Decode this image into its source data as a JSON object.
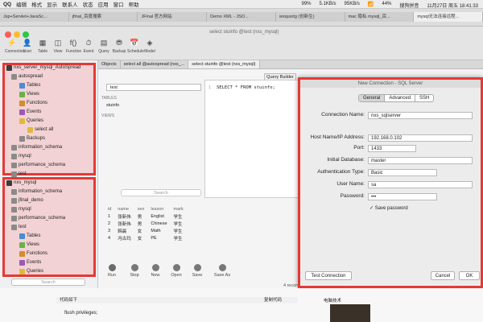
{
  "menubar": {
    "app": "QQ",
    "items": [
      "编辑",
      "格式",
      "显示",
      "联系人",
      "状态",
      "应用",
      "窗口",
      "帮助"
    ],
    "battery": "99%",
    "speed_up": "5.1KB/s",
    "speed_down": "95KB/s",
    "battery2": "44%",
    "search_label": "搜狗拼音",
    "datetime": "11月27日 周五 18:41:33"
  },
  "browser": {
    "tabs": [
      "Jsp+Servlet+JavaSc...",
      "jfinal_百度搜索",
      "JFinal 官方网站",
      "Demo XML - JSO...",
      "wxqusrtg (创新生)",
      "mac 隐私 mysql_百...",
      "mysql无法连接远程..."
    ]
  },
  "nav": {
    "window_title": "select stuinfo @test (nxs_mysql)",
    "tools": [
      {
        "name": "connection",
        "label": "Connection",
        "icon": "⚡"
      },
      {
        "name": "user",
        "label": "User",
        "icon": "👤"
      },
      {
        "name": "table",
        "label": "Table",
        "icon": "▦"
      },
      {
        "name": "view",
        "label": "View",
        "icon": "◫"
      },
      {
        "name": "function",
        "label": "Function",
        "icon": "f()"
      },
      {
        "name": "event",
        "label": "Event",
        "icon": "⏱"
      },
      {
        "name": "query",
        "label": "Query",
        "icon": "▤"
      },
      {
        "name": "backup",
        "label": "Backup",
        "icon": "⛃"
      },
      {
        "name": "schedule",
        "label": "Schedule",
        "icon": "📅"
      },
      {
        "name": "model",
        "label": "Model",
        "icon": "◈"
      }
    ]
  },
  "sidebar": {
    "group1": {
      "title": "nxs_server_mysql_AutoSpread",
      "items": [
        {
          "label": "autospread",
          "type": "db"
        },
        {
          "label": "Tables",
          "type": "tb"
        },
        {
          "label": "Views",
          "type": "vw"
        },
        {
          "label": "Functions",
          "type": "fn"
        },
        {
          "label": "Events",
          "type": "ev"
        },
        {
          "label": "Queries",
          "type": "qu"
        },
        {
          "label": "select all",
          "type": "qu"
        },
        {
          "label": "Backups",
          "type": "bk"
        },
        {
          "label": "information_schema",
          "type": "db"
        },
        {
          "label": "mysql",
          "type": "db"
        },
        {
          "label": "performance_schema",
          "type": "db"
        },
        {
          "label": "test",
          "type": "db"
        }
      ]
    },
    "group2": {
      "title": "nxs_mysql",
      "items": [
        {
          "label": "information_schema",
          "type": "db"
        },
        {
          "label": "jfinal_demo",
          "type": "db"
        },
        {
          "label": "mysql",
          "type": "db"
        },
        {
          "label": "performance_schema",
          "type": "db"
        },
        {
          "label": "test",
          "type": "db"
        },
        {
          "label": "Tables",
          "type": "tb"
        },
        {
          "label": "Views",
          "type": "vw"
        },
        {
          "label": "Functions",
          "type": "fn"
        },
        {
          "label": "Events",
          "type": "ev"
        },
        {
          "label": "Queries",
          "type": "qu"
        }
      ]
    },
    "search_placeholder": "Search"
  },
  "main": {
    "objtabs": [
      "Objects",
      "select all @autospread (nxs_...",
      "select stuinfo @test (nxs_mysql)"
    ],
    "editor_sql": "SELECT * FROM stuinfo;",
    "query_builder": "Query Builder",
    "db_select": "test",
    "tables_label": "TABLES",
    "table_item": "stuinfo",
    "views_label": "VIEWS",
    "search_placeholder": "Search",
    "results": {
      "headers": [
        "id",
        "name",
        "sex",
        "lesson",
        "mark"
      ],
      "rows": [
        [
          "1",
          "张新伟",
          "男",
          "Englist",
          "学生"
        ],
        [
          "2",
          "张新伟",
          "男",
          "Chinese",
          "学生"
        ],
        [
          "3",
          "韩晨",
          "女",
          "Math",
          "学生"
        ],
        [
          "4",
          "冯古玛",
          "女",
          "PE",
          "学生"
        ]
      ]
    },
    "record_count": "4 records",
    "actions": [
      "Run",
      "Stop",
      "New",
      "Open",
      "Save",
      "Save As"
    ]
  },
  "dialog": {
    "title": "New Connection - SQL Server",
    "tabs": [
      "General",
      "Advanced",
      "SSH"
    ],
    "fields": [
      {
        "label": "Connection Name:",
        "value": "nxs_sqlserver"
      },
      {
        "label": "Host Name/IP Address:",
        "value": "192.168.0.102"
      },
      {
        "label": "Port:",
        "value": "1433"
      },
      {
        "label": "Initial Database:",
        "value": "master"
      },
      {
        "label": "Authentication Type:",
        "value": "Basic"
      },
      {
        "label": "User Name:",
        "value": "sa"
      },
      {
        "label": "Password:",
        "value": "•••"
      }
    ],
    "save_password": "Save password",
    "test_button": "Test Connection",
    "cancel_button": "Cancel",
    "ok_button": "OK"
  },
  "web": {
    "code_label": "代码如下",
    "copy_label": "复制代码",
    "snippet": "flush privileges;",
    "side_label": "电脑技术"
  },
  "colors": {
    "highlight": "#e53935"
  }
}
